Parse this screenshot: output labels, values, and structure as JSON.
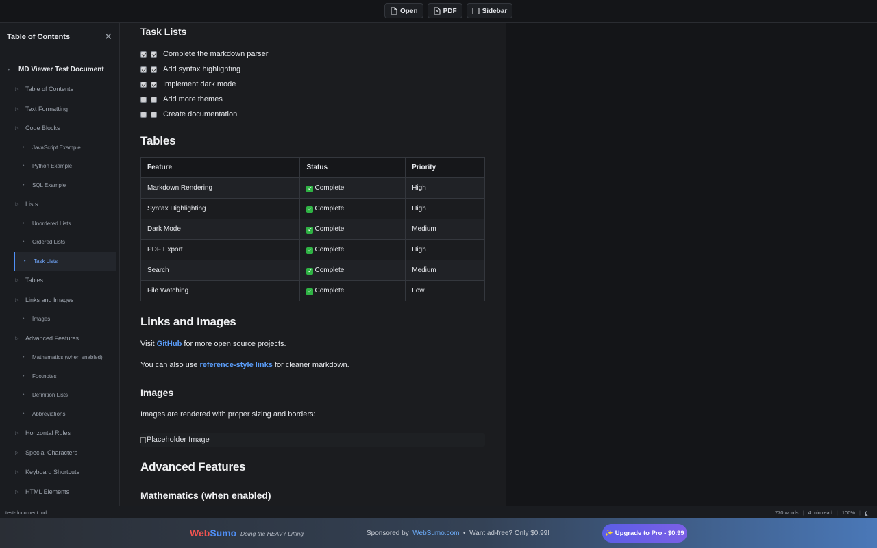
{
  "toolbar": {
    "open_label": "Open",
    "pdf_label": "PDF",
    "sidebar_label": "Sidebar"
  },
  "sidebar": {
    "title": "Table of Contents",
    "items": [
      {
        "level": 1,
        "label": "MD Viewer Test Document"
      },
      {
        "level": 2,
        "label": "Table of Contents"
      },
      {
        "level": 2,
        "label": "Text Formatting"
      },
      {
        "level": 2,
        "label": "Code Blocks"
      },
      {
        "level": 3,
        "label": "JavaScript Example"
      },
      {
        "level": 3,
        "label": "Python Example"
      },
      {
        "level": 3,
        "label": "SQL Example"
      },
      {
        "level": 2,
        "label": "Lists"
      },
      {
        "level": 3,
        "label": "Unordered Lists"
      },
      {
        "level": 3,
        "label": "Ordered Lists"
      },
      {
        "level": 3,
        "label": "Task Lists",
        "active": true
      },
      {
        "level": 2,
        "label": "Tables"
      },
      {
        "level": 2,
        "label": "Links and Images"
      },
      {
        "level": 3,
        "label": "Images"
      },
      {
        "level": 2,
        "label": "Advanced Features"
      },
      {
        "level": 3,
        "label": "Mathematics (when enabled)"
      },
      {
        "level": 3,
        "label": "Footnotes"
      },
      {
        "level": 3,
        "label": "Definition Lists"
      },
      {
        "level": 3,
        "label": "Abbreviations"
      },
      {
        "level": 2,
        "label": "Horizontal Rules"
      },
      {
        "level": 2,
        "label": "Special Characters"
      },
      {
        "level": 2,
        "label": "Keyboard Shortcuts"
      },
      {
        "level": 2,
        "label": "HTML Elements"
      }
    ]
  },
  "content": {
    "task_lists_heading": "Task Lists",
    "tasks": [
      {
        "label": "Complete the markdown parser",
        "done": true
      },
      {
        "label": "Add syntax highlighting",
        "done": true
      },
      {
        "label": "Implement dark mode",
        "done": true
      },
      {
        "label": "Add more themes",
        "done": false
      },
      {
        "label": "Create documentation",
        "done": false
      }
    ],
    "tables_heading": "Tables",
    "table": {
      "headers": [
        "Feature",
        "Status",
        "Priority"
      ],
      "rows": [
        [
          "Markdown Rendering",
          "Complete",
          "High"
        ],
        [
          "Syntax Highlighting",
          "Complete",
          "High"
        ],
        [
          "Dark Mode",
          "Complete",
          "Medium"
        ],
        [
          "PDF Export",
          "Complete",
          "High"
        ],
        [
          "Search",
          "Complete",
          "Medium"
        ],
        [
          "File Watching",
          "Complete",
          "Low"
        ]
      ]
    },
    "links_heading": "Links and Images",
    "visit_prefix": "Visit ",
    "github_link": "GitHub",
    "visit_suffix": " for more open source projects.",
    "ref_prefix": "You can also use ",
    "ref_link": "reference-style links",
    "ref_suffix": " for cleaner markdown.",
    "images_heading": "Images",
    "images_text": "Images are rendered with proper sizing and borders:",
    "image_alt": "Placeholder Image",
    "advanced_heading": "Advanced Features",
    "math_heading": "Mathematics (when enabled)"
  },
  "status": {
    "filename": "test-document.md",
    "words": "770 words",
    "read_time": "4 min read",
    "zoom": "100%"
  },
  "ad": {
    "brand_web": "Web",
    "brand_sumo": "Sumo",
    "tagline": "Doing the HEAVY Lifting",
    "sponsored_by": "Sponsored by",
    "sponsor_link": "WebSumo.com",
    "bullet": "•",
    "adfree_text": "Want ad-free? Only $0.99!",
    "upgrade_label": "✨ Upgrade to Pro - $0.99"
  },
  "colors": {
    "accent": "#4f8ff7",
    "complete": "#2fb344",
    "brand_red": "#ef5350"
  }
}
